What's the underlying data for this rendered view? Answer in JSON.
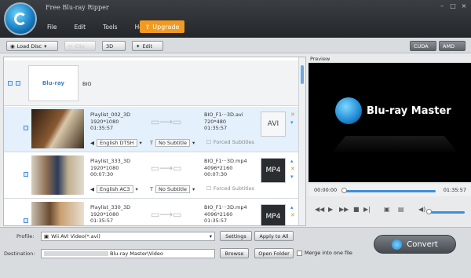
{
  "app": {
    "title": "Free Blu-ray Ripper"
  },
  "menu": [
    "File",
    "Edit",
    "Tools",
    "Help"
  ],
  "upgrade_label": "Upgrade",
  "window_controls": {
    "minimize": "–",
    "maximize": "□",
    "close": "×"
  },
  "toolbar": {
    "load_disc": "Load Disc",
    "clip": "Clip",
    "three_d": "3D",
    "edit": "Edit",
    "cuda": "CUDA",
    "amd": "AMD"
  },
  "disc": {
    "name": "BIO",
    "logo_text": "Blu-ray"
  },
  "videos": [
    {
      "title": "Playlist_002_3D",
      "resolution": "1920*1080",
      "duration": "01:35:57",
      "out_name": "BIO_F1···3D.avi",
      "out_resolution": "720*480",
      "out_duration": "01:35:57",
      "audio": "English DTSH",
      "subtitle": "No Subtitle",
      "forced": "Forced Subtitles",
      "out_format": "AVI"
    },
    {
      "title": "Playlist_333_3D",
      "resolution": "1920*1080",
      "duration": "00:07:30",
      "out_name": "BIO_F1···3D.mp4",
      "out_resolution": "4096*2160",
      "out_duration": "00:07:30",
      "audio": "English AC3",
      "subtitle": "No Subtitle",
      "forced": "Forced Subtitles",
      "out_format": "MP4"
    },
    {
      "title": "Playlist_330_3D",
      "resolution": "1920*1080",
      "duration": "01:35:57",
      "out_name": "BIO_F1···3D.mp4",
      "out_resolution": "4096*2160",
      "out_duration": "01:35:57",
      "audio": "",
      "subtitle": "",
      "forced": "",
      "out_format": "MP4"
    }
  ],
  "preview": {
    "label": "Preview",
    "brand_text": "Blu-ray Master",
    "time_start": "00:00:00",
    "time_end": "01:35:57",
    "progress": 0
  },
  "bottom": {
    "profile_label": "Profile:",
    "profile_value": "Wii AVI Video(*.avi)",
    "settings": "Settings",
    "apply_all": "Apply to All",
    "destination_label": "Destination:",
    "destination_value": "Blu-ray Master\\Video",
    "browse": "Browse",
    "open_folder": "Open Folder",
    "merge": "Merge into one file",
    "convert": "Convert"
  }
}
